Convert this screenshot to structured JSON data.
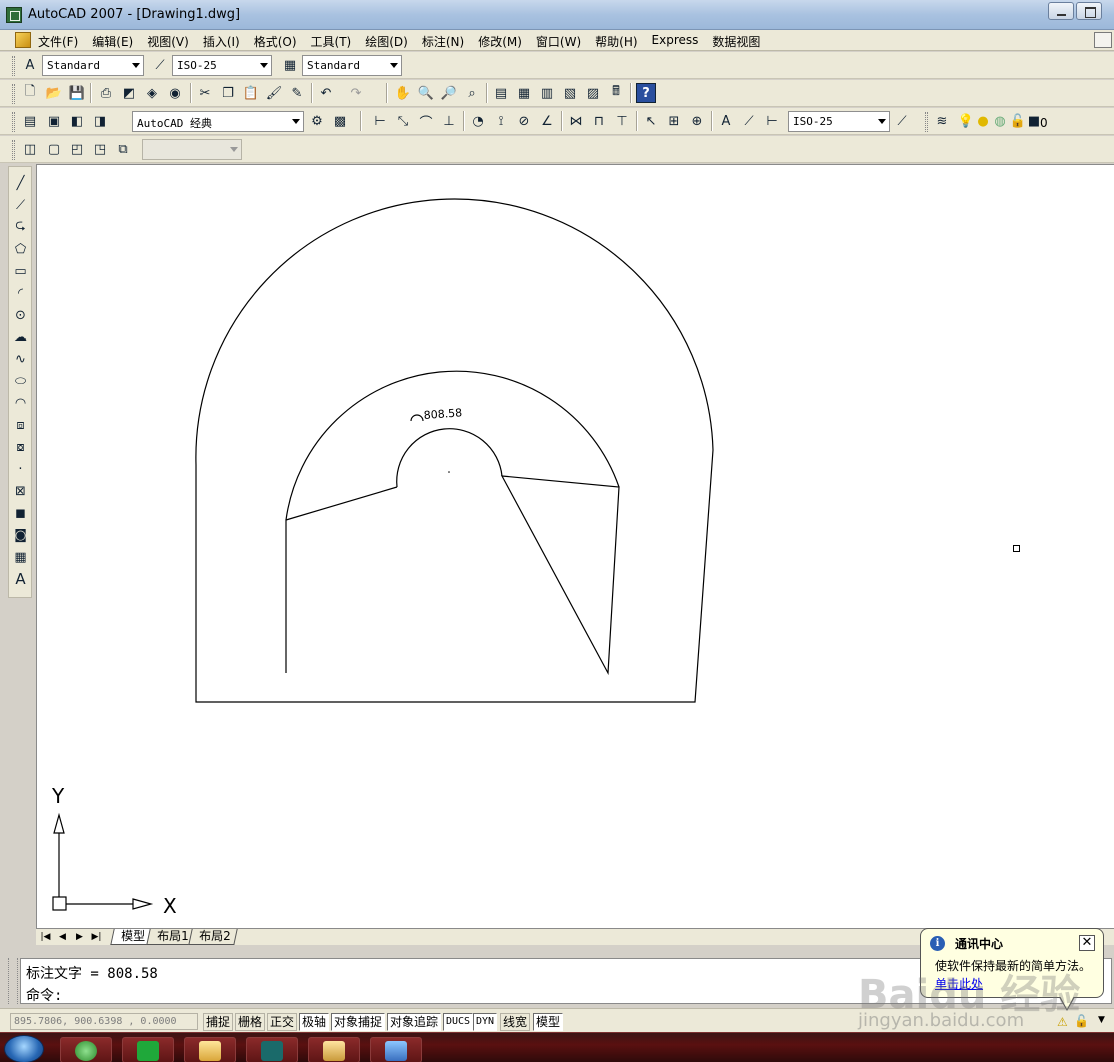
{
  "window": {
    "title": "AutoCAD 2007 - [Drawing1.dwg]"
  },
  "menu": {
    "items": [
      "文件(F)",
      "编辑(E)",
      "视图(V)",
      "插入(I)",
      "格式(O)",
      "工具(T)",
      "绘图(D)",
      "标注(N)",
      "修改(M)",
      "窗口(W)",
      "帮助(H)",
      "Express",
      "数据视图"
    ]
  },
  "styles_toolbar": {
    "text_style": "Standard",
    "dim_style": "ISO-25",
    "table_style": "Standard"
  },
  "workspace_toolbar": {
    "workspace": "AutoCAD 经典"
  },
  "dimension_toolbar": {
    "dim_style": "ISO-25"
  },
  "layer_toolbar": {
    "current_layer": "0"
  },
  "drawing": {
    "dimension_label": "808.58",
    "ucs_x_label": "X",
    "ucs_y_label": "Y"
  },
  "layout_tabs": [
    "模型",
    "布局1",
    "布局2"
  ],
  "command_window": {
    "history_line": "标注文字 = 808.58",
    "prompt": "命令:"
  },
  "status_bar": {
    "coordinates": "895.7806,  900.6398 , 0.0000",
    "buttons": [
      "捕捉",
      "栅格",
      "正交",
      "极轴",
      "对象捕捉",
      "对象追踪",
      "DUCS",
      "DYN",
      "线宽",
      "模型"
    ]
  },
  "notification": {
    "title": "通讯中心",
    "message": "使软件保持最新的简单方法。",
    "link": "单击此处"
  },
  "watermark": {
    "logo": "Baidu 经验",
    "url": "jingyan.baidu.com"
  },
  "icons": {
    "toolbar": [
      "new-icon",
      "open-icon",
      "save-icon",
      "print-icon",
      "plot-preview-icon",
      "publish-icon",
      "cut-icon",
      "copy-icon",
      "paste-icon",
      "match-properties-icon",
      "undo-icon",
      "redo-icon",
      "pan-icon",
      "zoom-realtime-icon",
      "help-icon"
    ],
    "draw": [
      "line-icon",
      "construction-line-icon",
      "polyline-icon",
      "polygon-icon",
      "rectangle-icon",
      "arc-icon",
      "circle-icon",
      "revcloud-icon",
      "spline-icon",
      "ellipse-icon",
      "ellipse-arc-icon",
      "insert-block-icon",
      "make-block-icon",
      "point-icon",
      "hatch-icon",
      "gradient-icon",
      "region-icon",
      "table-icon",
      "mtext-icon"
    ]
  },
  "colors": {
    "canvas": "#ffffff",
    "linework": "#000000",
    "taskbar": "#5a1010",
    "balloon": "#ffffe1"
  }
}
